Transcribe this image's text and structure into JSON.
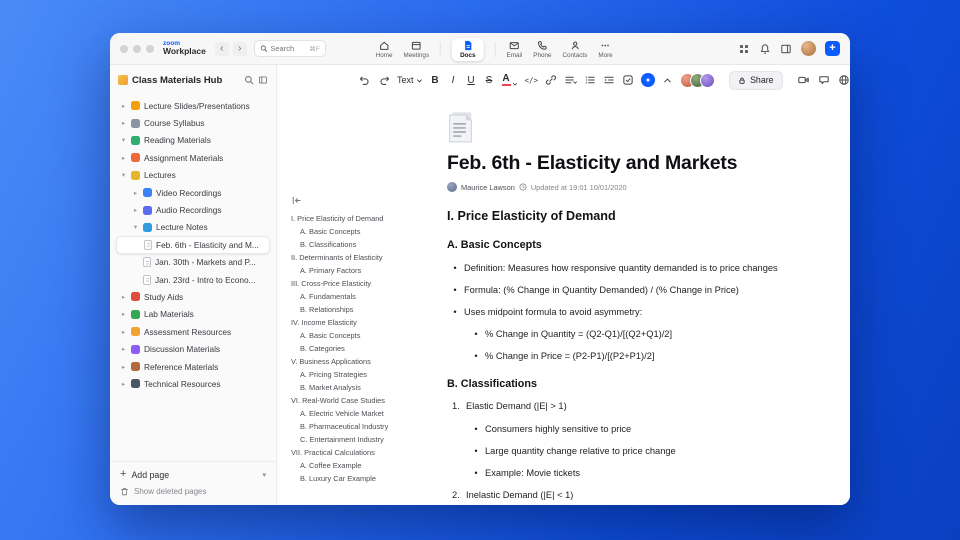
{
  "titlebar": {
    "brand_top": "zoom",
    "brand_bottom": "Workplace",
    "search_placeholder": "Search",
    "search_shortcut": "⌘F",
    "tabs": [
      {
        "label": "Home"
      },
      {
        "label": "Meetings"
      },
      {
        "label": "Docs"
      },
      {
        "label": "Email"
      },
      {
        "label": "Phone"
      },
      {
        "label": "Contacts"
      },
      {
        "label": "More"
      }
    ]
  },
  "sidebar": {
    "title": "Class Materials Hub",
    "items": [
      {
        "label": "Lecture Slides/Presentations",
        "icon_color": "#f59e0b"
      },
      {
        "label": "Course Syllabus",
        "icon_color": "#8a94a6"
      },
      {
        "label": "Reading Materials",
        "icon_color": "#2eaf6e"
      },
      {
        "label": "Assignment Materials",
        "icon_color": "#ef6a3a"
      },
      {
        "label": "Lectures",
        "icon_color": "#e7b52a"
      },
      {
        "label": "Video Recordings",
        "icon_color": "#3b82f6"
      },
      {
        "label": "Audio Recordings",
        "icon_color": "#5a6cf0"
      },
      {
        "label": "Lecture Notes",
        "icon_color": "#2f9ce0"
      },
      {
        "label": "Feb. 6th - Elasticity and M..."
      },
      {
        "label": "Jan. 30th - Markets and P..."
      },
      {
        "label": "Jan. 23rd - Intro to Econo..."
      },
      {
        "label": "Study Aids",
        "icon_color": "#e04a3f"
      },
      {
        "label": "Lab Materials",
        "icon_color": "#34a853"
      },
      {
        "label": "Assessment Resources",
        "icon_color": "#f0a32e"
      },
      {
        "label": "Discussion Materials",
        "icon_color": "#8b5cf6"
      },
      {
        "label": "Reference Materials",
        "icon_color": "#b06a3b"
      },
      {
        "label": "Technical Resources",
        "icon_color": "#4a5568"
      }
    ],
    "add_page": "Add page",
    "show_deleted": "Show deleted pages"
  },
  "toolbar": {
    "text_style": "Text",
    "share": "Share"
  },
  "doc": {
    "title": "Feb. 6th - Elasticity and Markets",
    "author": "Maurice Lawson",
    "updated": "Updated at 19:01 10/01/2020",
    "outline": [
      {
        "text": "I. Price Elasticity of Demand",
        "level": 0
      },
      {
        "text": "A. Basic Concepts",
        "level": 1
      },
      {
        "text": "B. Classifications",
        "level": 1
      },
      {
        "text": "II. Determinants of Elasticity",
        "level": 0
      },
      {
        "text": "A. Primary Factors",
        "level": 1
      },
      {
        "text": "III. Cross-Price Elasticity",
        "level": 0
      },
      {
        "text": "A. Fundamentals",
        "level": 1
      },
      {
        "text": "B. Relationships",
        "level": 1
      },
      {
        "text": "IV. Income Elasticity",
        "level": 0
      },
      {
        "text": "A. Basic Concepts",
        "level": 1
      },
      {
        "text": "B. Categories",
        "level": 1
      },
      {
        "text": "V. Business Applications",
        "level": 0
      },
      {
        "text": "A. Pricing Strategies",
        "level": 1
      },
      {
        "text": "B. Market Analysis",
        "level": 1
      },
      {
        "text": "VI. Real-World Case Studies",
        "level": 0
      },
      {
        "text": "A. Electric Vehicle Market",
        "level": 1
      },
      {
        "text": "B. Pharmaceutical Industry",
        "level": 1
      },
      {
        "text": "C. Entertainment Industry",
        "level": 1
      },
      {
        "text": "VII. Practical Calculations",
        "level": 0
      },
      {
        "text": "A. Coffee Example",
        "level": 1
      },
      {
        "text": "B. Luxury Car Example",
        "level": 1
      }
    ],
    "content": [
      {
        "type": "h2",
        "text": "I. Price Elasticity of Demand"
      },
      {
        "type": "h3",
        "text": "A. Basic Concepts"
      },
      {
        "type": "bullet",
        "level": 1,
        "text": "Definition: Measures how responsive quantity demanded is to price changes"
      },
      {
        "type": "bullet",
        "level": 1,
        "text": "Formula: (% Change in Quantity Demanded) / (% Change in Price)"
      },
      {
        "type": "bullet",
        "level": 1,
        "text": "Uses midpoint formula to avoid asymmetry:"
      },
      {
        "type": "bullet",
        "level": 2,
        "text": "% Change in Quantity = (Q2-Q1)/[(Q2+Q1)/2]"
      },
      {
        "type": "bullet",
        "level": 2,
        "text": "% Change in Price = (P2-P1)/[(P2+P1)/2]"
      },
      {
        "type": "h3",
        "text": "B. Classifications"
      },
      {
        "type": "numbered",
        "marker": "1.",
        "text": "Elastic Demand (|E| > 1)"
      },
      {
        "type": "bullet",
        "level": 2,
        "text": "Consumers highly sensitive to price"
      },
      {
        "type": "bullet",
        "level": 2,
        "text": "Large quantity change relative to price change"
      },
      {
        "type": "bullet",
        "level": 2,
        "text": "Example: Movie tickets"
      },
      {
        "type": "numbered",
        "marker": "2.",
        "text": "Inelastic Demand (|E| < 1)"
      }
    ]
  }
}
